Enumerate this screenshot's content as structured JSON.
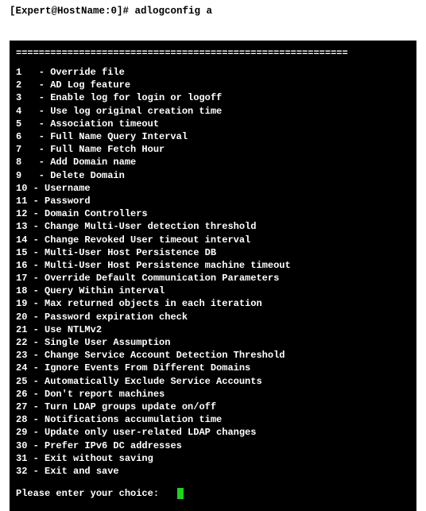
{
  "shell": {
    "prompt_text": "[Expert@HostName:0]# adlogconfig a"
  },
  "terminal": {
    "separator": "==========================================================",
    "menu": [
      {
        "num": "1",
        "label": "Override file"
      },
      {
        "num": "2",
        "label": "AD Log feature"
      },
      {
        "num": "3",
        "label": "Enable log for login or logoff"
      },
      {
        "num": "4",
        "label": "Use log original creation time"
      },
      {
        "num": "5",
        "label": "Association timeout"
      },
      {
        "num": "6",
        "label": "Full Name Query Interval"
      },
      {
        "num": "7",
        "label": "Full Name Fetch Hour"
      },
      {
        "num": "8",
        "label": "Add Domain name"
      },
      {
        "num": "9",
        "label": "Delete Domain"
      },
      {
        "num": "10",
        "label": "Username"
      },
      {
        "num": "11",
        "label": "Password"
      },
      {
        "num": "12",
        "label": "Domain Controllers"
      },
      {
        "num": "13",
        "label": "Change Multi-User detection threshold"
      },
      {
        "num": "14",
        "label": "Change Revoked User timeout interval"
      },
      {
        "num": "15",
        "label": "Multi-User Host Persistence DB"
      },
      {
        "num": "16",
        "label": "Multi-User Host Persistence machine timeout"
      },
      {
        "num": "17",
        "label": "Override Default Communication Parameters"
      },
      {
        "num": "18",
        "label": "Query Within interval"
      },
      {
        "num": "19",
        "label": "Max returned objects in each iteration"
      },
      {
        "num": "20",
        "label": "Password expiration check"
      },
      {
        "num": "21",
        "label": "Use NTLMv2"
      },
      {
        "num": "22",
        "label": "Single User Assumption"
      },
      {
        "num": "23",
        "label": "Change Service Account Detection Threshold"
      },
      {
        "num": "24",
        "label": "Ignore Events From Different Domains"
      },
      {
        "num": "25",
        "label": "Automatically Exclude Service Accounts"
      },
      {
        "num": "26",
        "label": "Don't report machines"
      },
      {
        "num": "27",
        "label": "Turn LDAP groups update on/off"
      },
      {
        "num": "28",
        "label": "Notifications accumulation time"
      },
      {
        "num": "29",
        "label": "Update only user-related LDAP changes"
      },
      {
        "num": "30",
        "label": "Prefer IPv6 DC addresses"
      },
      {
        "num": "31",
        "label": "Exit without saving"
      },
      {
        "num": "32",
        "label": "Exit and save"
      }
    ],
    "prompt": "Please enter your choice:",
    "input_value": ""
  }
}
